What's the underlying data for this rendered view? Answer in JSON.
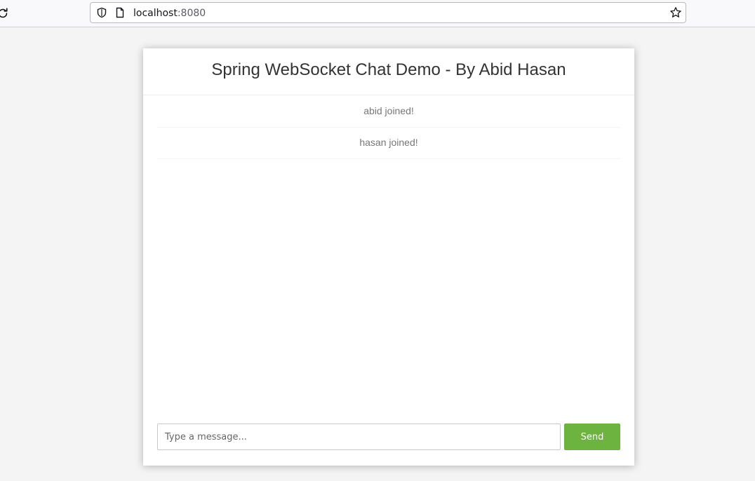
{
  "browser": {
    "url_host": "localhost",
    "url_port": ":8080",
    "icons": [
      "reload-icon",
      "shield-icon",
      "page-icon",
      "bookmark-star-icon"
    ]
  },
  "chat": {
    "title": "Spring WebSocket Chat Demo - By Abid Hasan",
    "messages": [
      {
        "type": "event",
        "text": "abid joined!"
      },
      {
        "type": "event",
        "text": "hasan joined!"
      }
    ],
    "input": {
      "value": "",
      "placeholder": "Type a message..."
    },
    "send_label": "Send",
    "accent_color": "#6db33f"
  }
}
